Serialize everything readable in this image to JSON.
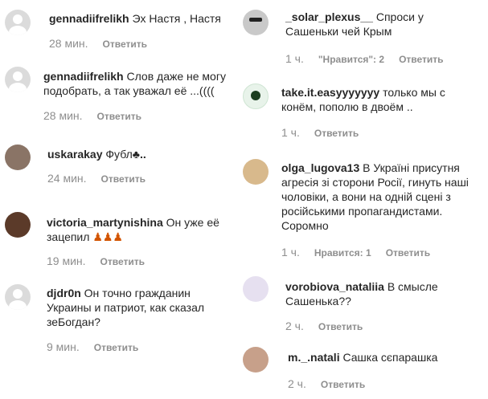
{
  "left": [
    {
      "user": "gennadiifrelikh",
      "text": "Эх Настя , Настя",
      "time": "28 мин.",
      "reply": "Ответить"
    },
    {
      "user": "gennadiifrelikh",
      "text": "Слов даже не могу подобрать, а так уважал её ...((((",
      "time": "28 мин.",
      "reply": "Ответить"
    },
    {
      "user": "uskarakay",
      "text": "Фубл",
      "emoji": "♣..",
      "time": "24 мин.",
      "reply": "Ответить"
    },
    {
      "user": "victoria_martynishina",
      "text": "Он уже её зацепил",
      "emoji": "♟♟♟",
      "time": "19 мин.",
      "reply": "Ответить"
    },
    {
      "user": "djdr0n",
      "text": "Он точно гражданин Украины и патриот, как сказал зеБогдан?",
      "time": "9 мин.",
      "reply": "Ответить"
    }
  ],
  "right": [
    {
      "user": "_solar_plexus__",
      "text": "Спроси у Сашеньки чей Крым",
      "time": "1 ч.",
      "likes": "\"Нравится\": 2",
      "reply": "Ответить"
    },
    {
      "user": "take.it.easyyyyyyy",
      "text": "только мы с конём, пополю в двоём ..",
      "time": "1 ч.",
      "reply": "Ответить"
    },
    {
      "user": "olga_lugova13",
      "text": "В Україні присутня агресія зі сторони Росії, гинуть наші чоловіки, а вони на одній сцені з російськими пропагандистами. Соромно",
      "time": "1 ч.",
      "likes": "Нравится: 1",
      "reply": "Ответить"
    },
    {
      "user": "vorobiova_nataliia",
      "text": "В смысле Сашенька??",
      "time": "2 ч.",
      "reply": "Ответить"
    },
    {
      "user": "m._.natali",
      "text": "Сашка сєпарашка",
      "time": "2 ч.",
      "reply": "Ответить"
    }
  ]
}
